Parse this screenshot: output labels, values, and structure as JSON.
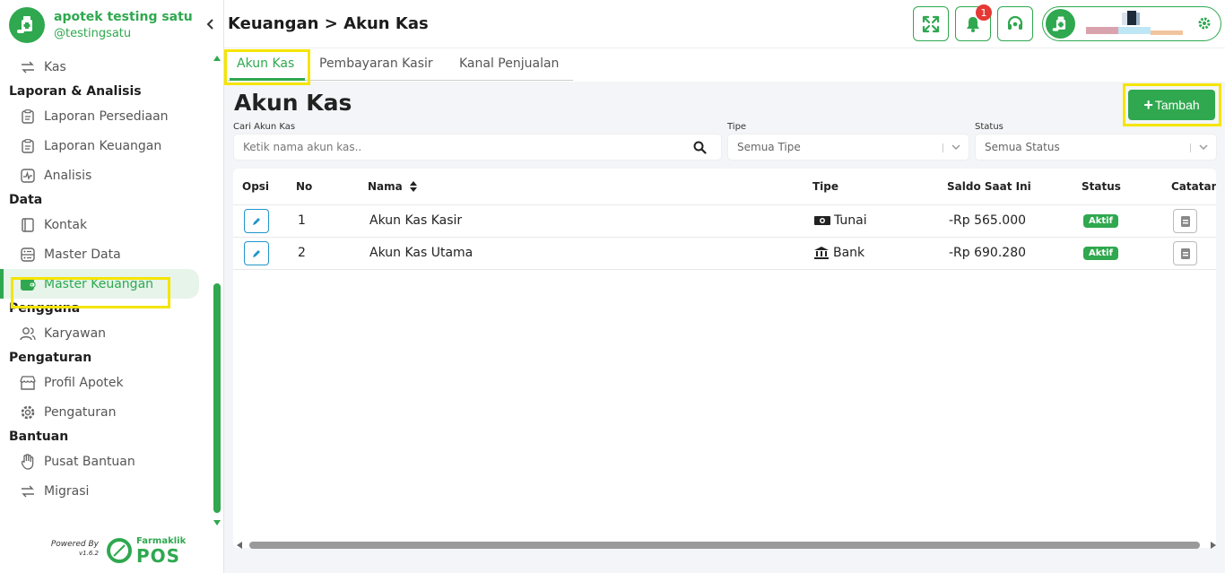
{
  "brand": {
    "name": "apotek testing satu",
    "handle": "@testingsatu"
  },
  "header": {
    "title": "Keuangan > Akun Kas",
    "notification_count": "1"
  },
  "sidebar": {
    "items": [
      {
        "type": "item",
        "label": "Kas",
        "icon": "exchange-icon"
      },
      {
        "type": "section",
        "label": "Laporan & Analisis"
      },
      {
        "type": "item",
        "label": "Laporan Persediaan",
        "icon": "clipboard-icon"
      },
      {
        "type": "item",
        "label": "Laporan Keuangan",
        "icon": "clipboard-icon"
      },
      {
        "type": "item",
        "label": "Analisis",
        "icon": "activity-icon"
      },
      {
        "type": "section",
        "label": "Data"
      },
      {
        "type": "item",
        "label": "Kontak",
        "icon": "contact-book-icon"
      },
      {
        "type": "item",
        "label": "Master Data",
        "icon": "database-icon"
      },
      {
        "type": "item",
        "label": "Master Keuangan",
        "icon": "wallet-icon",
        "active": true
      },
      {
        "type": "section",
        "label": "Pengguna"
      },
      {
        "type": "item",
        "label": "Karyawan",
        "icon": "users-icon"
      },
      {
        "type": "section",
        "label": "Pengaturan"
      },
      {
        "type": "item",
        "label": "Profil Apotek",
        "icon": "store-icon"
      },
      {
        "type": "item",
        "label": "Pengaturan",
        "icon": "gear-icon"
      },
      {
        "type": "section",
        "label": "Bantuan"
      },
      {
        "type": "item",
        "label": "Pusat Bantuan",
        "icon": "hand-icon"
      },
      {
        "type": "item",
        "label": "Migrasi",
        "icon": "exchange-icon"
      }
    ]
  },
  "powered": {
    "label": "Powered By",
    "version": "v1.6.2",
    "logo_small": "Farmaklik",
    "logo_big": "POS"
  },
  "tabs": [
    {
      "label": "Akun Kas",
      "active": true
    },
    {
      "label": "Pembayaran Kasir",
      "active": false
    },
    {
      "label": "Kanal Penjualan",
      "active": false
    }
  ],
  "main": {
    "title": "Akun Kas",
    "add_button": "Tambah",
    "filters": {
      "search_label": "Cari Akun Kas",
      "search_placeholder": "Ketik nama akun kas..",
      "type_label": "Tipe",
      "type_value": "Semua Tipe",
      "status_label": "Status",
      "status_value": "Semua Status"
    }
  },
  "table": {
    "headers": {
      "opsi": "Opsi",
      "no": "No",
      "nama": "Nama",
      "tipe": "Tipe",
      "saldo": "Saldo Saat Ini",
      "status": "Status",
      "catatan": "Catatan"
    },
    "rows": [
      {
        "no": "1",
        "nama": "Akun Kas Kasir",
        "tipe": "Tunai",
        "tipe_icon": "cash-icon",
        "saldo": "-Rp 565.000",
        "status": "Aktif"
      },
      {
        "no": "2",
        "nama": "Akun Kas Utama",
        "tipe": "Bank",
        "tipe_icon": "bank-icon",
        "saldo": "-Rp 690.280",
        "status": "Aktif"
      }
    ]
  },
  "colors": {
    "accent": "#2fa84f",
    "highlight": "#f5e400",
    "edit": "#2196c9",
    "badge": "#e53935"
  }
}
